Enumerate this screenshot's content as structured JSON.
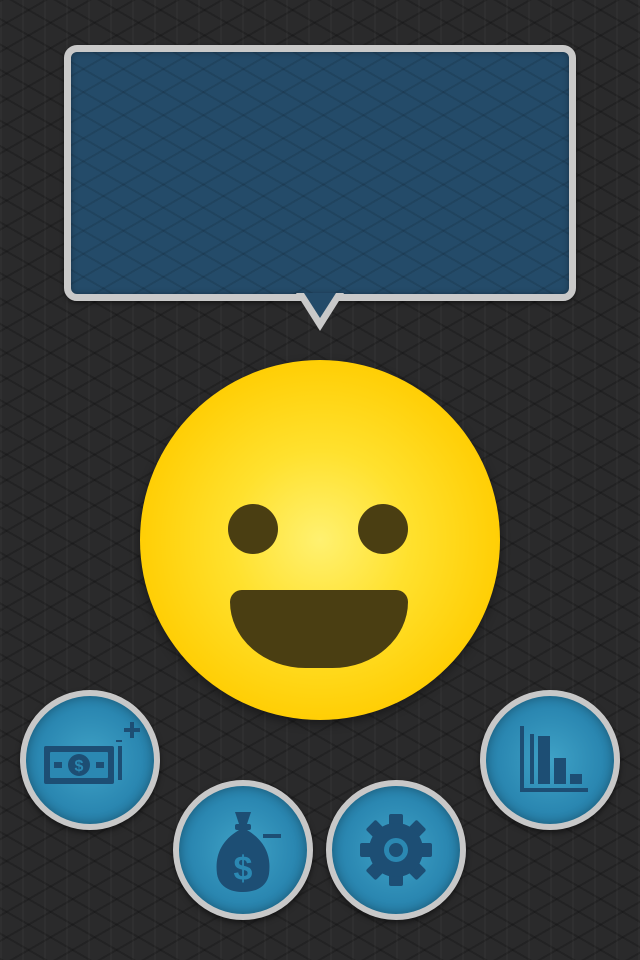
{
  "speech_bubble": {
    "message": ""
  },
  "mascot": {
    "expression": "happy",
    "color": "#ffcc00"
  },
  "buttons": [
    {
      "id": "add-income",
      "icon": "cash-plus-icon"
    },
    {
      "id": "add-expense",
      "icon": "money-bag-minus-icon"
    },
    {
      "id": "settings",
      "icon": "gear-icon"
    },
    {
      "id": "statistics",
      "icon": "bar-chart-icon"
    }
  ],
  "colors": {
    "background": "#2a2a2b",
    "bubble_fill": "#244b69",
    "bubble_border": "#c9c9c9",
    "button_fill": "#2b88b2",
    "icon_color": "#1d4e74",
    "smiley_features": "#4a3e12"
  }
}
